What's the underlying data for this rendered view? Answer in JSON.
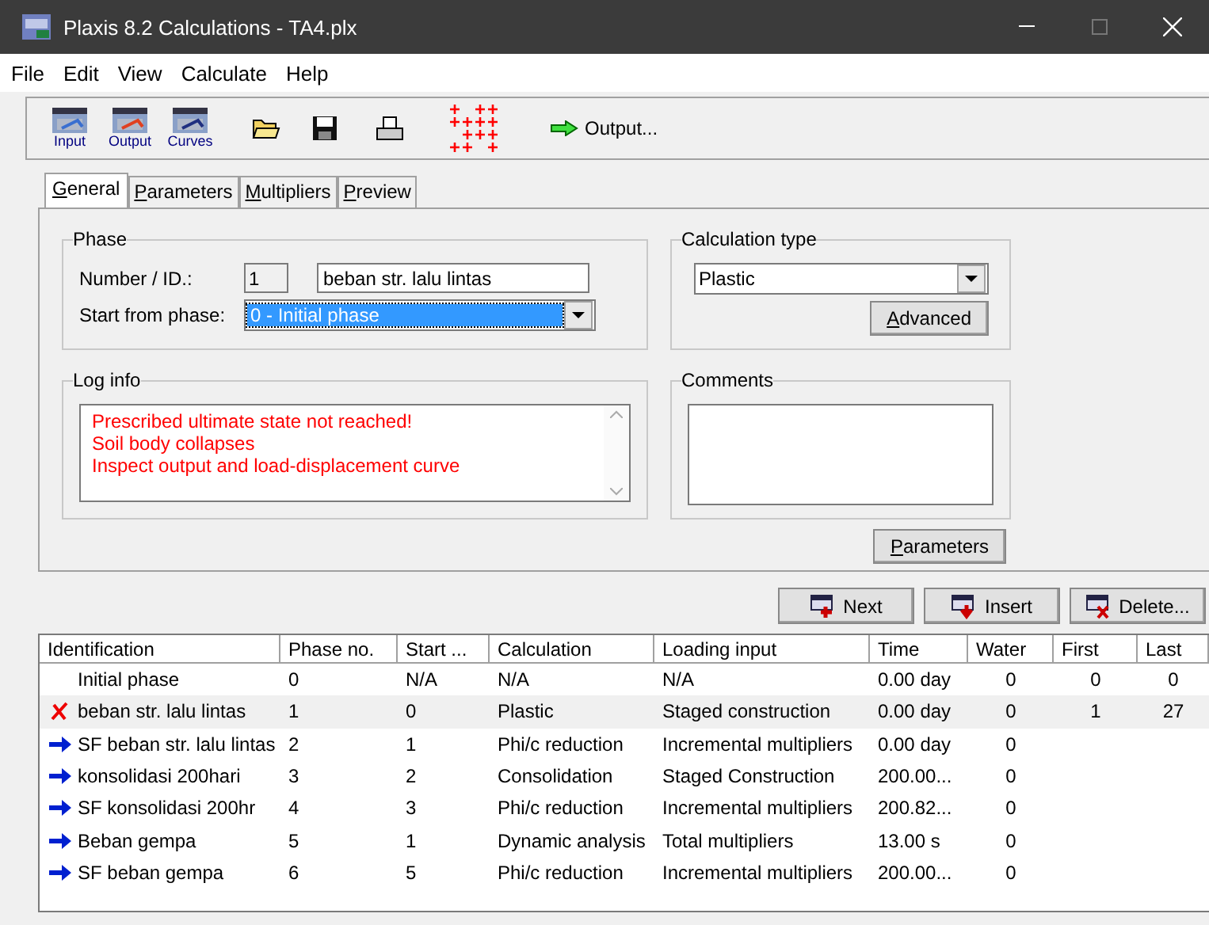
{
  "window": {
    "title": "Plaxis 8.2 Calculations - TA4.plx"
  },
  "menu": [
    "File",
    "Edit",
    "View",
    "Calculate",
    "Help"
  ],
  "toolbar": {
    "buttons": [
      {
        "label": "Input",
        "kind": "input"
      },
      {
        "label": "Output",
        "kind": "output"
      },
      {
        "label": "Curves",
        "kind": "curves"
      }
    ],
    "output_link": "Output..."
  },
  "tabs": [
    {
      "label": "General",
      "selected": true
    },
    {
      "label": "Parameters",
      "selected": false
    },
    {
      "label": "Multipliers",
      "selected": false
    },
    {
      "label": "Preview",
      "selected": false
    }
  ],
  "phase": {
    "title": "Phase",
    "number_label": "Number / ID.:",
    "number": "1",
    "name": "beban str. lalu lintas",
    "start_label": "Start from phase:",
    "start_from": "0 - Initial phase"
  },
  "calculation_type": {
    "title": "Calculation type",
    "value": "Plastic",
    "advanced_button": "Advanced"
  },
  "log_info": {
    "title": "Log info",
    "lines": [
      "Prescribed ultimate state not reached!",
      "Soil body collapses",
      "Inspect output and load-displacement curve"
    ]
  },
  "comments": {
    "title": "Comments"
  },
  "parameters_button": "Parameters",
  "phase_buttons": [
    {
      "label": "Next",
      "kind": "next"
    },
    {
      "label": "Insert",
      "kind": "insert"
    },
    {
      "label": "Delete...",
      "kind": "delete"
    }
  ],
  "table": {
    "columns": [
      "Identification",
      "Phase no.",
      "Start ...",
      "Calculation",
      "Loading input",
      "Time",
      "Water",
      "First",
      "Last"
    ],
    "rows": [
      {
        "kind": "none",
        "selected": false,
        "cells": [
          "Initial phase",
          "0",
          "N/A",
          "N/A",
          "N/A",
          "0.00 day",
          "0",
          "0",
          "0"
        ]
      },
      {
        "kind": "failed",
        "selected": true,
        "cells": [
          "beban str. lalu lintas",
          "1",
          "0",
          "Plastic",
          "Staged construction",
          "0.00 day",
          "0",
          "1",
          "27"
        ]
      },
      {
        "kind": "pending",
        "selected": false,
        "cells": [
          "SF beban str. lalu lintas",
          "2",
          "1",
          "Phi/c reduction",
          "Incremental multipliers",
          "0.00 day",
          "0"
        ]
      },
      {
        "kind": "pending",
        "selected": false,
        "cells": [
          "konsolidasi 200hari",
          "3",
          "2",
          "Consolidation",
          "Staged Construction",
          "200.00...",
          "0"
        ]
      },
      {
        "kind": "pending",
        "selected": false,
        "cells": [
          "SF konsolidasi 200hr",
          "4",
          "3",
          "Phi/c reduction",
          "Incremental multipliers",
          "200.82...",
          "0"
        ]
      },
      {
        "kind": "pending",
        "selected": false,
        "cells": [
          "Beban gempa",
          "5",
          "1",
          "Dynamic analysis",
          "Total multipliers",
          "13.00 s",
          "0"
        ]
      },
      {
        "kind": "pending",
        "selected": false,
        "cells": [
          "SF beban gempa",
          "6",
          "5",
          "Phi/c reduction",
          "Incremental multipliers",
          "200.00...",
          "0"
        ]
      }
    ]
  }
}
